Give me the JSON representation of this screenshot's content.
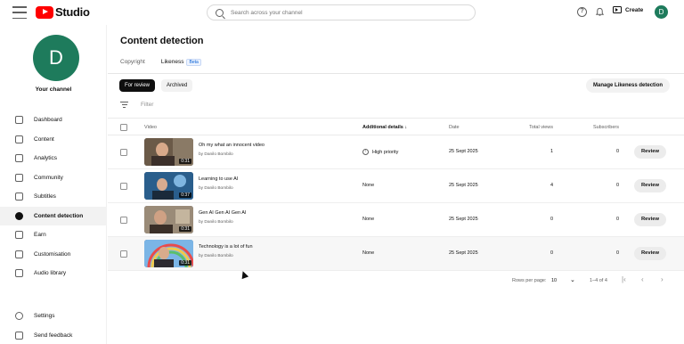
{
  "app": {
    "logo_text": "Studio"
  },
  "search": {
    "placeholder": "Search across your channel"
  },
  "header": {
    "create_label": "Create",
    "avatar_letter": "D",
    "help_icon": "help-icon",
    "bell_icon": "bell-icon"
  },
  "sidebar": {
    "avatar_letter": "D",
    "channel_label": "Your channel",
    "items": [
      {
        "label": "Dashboard",
        "icon": "dashboard-icon"
      },
      {
        "label": "Content",
        "icon": "content-icon"
      },
      {
        "label": "Analytics",
        "icon": "analytics-icon"
      },
      {
        "label": "Community",
        "icon": "community-icon"
      },
      {
        "label": "Subtitles",
        "icon": "subtitles-icon"
      },
      {
        "label": "Content detection",
        "icon": "content-detection-icon",
        "active": true
      },
      {
        "label": "Earn",
        "icon": "dollar-icon"
      },
      {
        "label": "Customisation",
        "icon": "customisation-icon"
      },
      {
        "label": "Audio library",
        "icon": "audio-library-icon"
      }
    ],
    "bottom": [
      {
        "label": "Settings",
        "icon": "gear-icon"
      },
      {
        "label": "Send feedback",
        "icon": "feedback-icon"
      }
    ]
  },
  "main": {
    "title": "Content detection",
    "tabs": [
      {
        "label": "Copyright"
      },
      {
        "label": "Likeness",
        "badge": "Beta",
        "active": true
      }
    ],
    "chips": {
      "review": "For review",
      "archived": "Archived"
    },
    "manage_button": "Manage Likeness detection",
    "filter_placeholder": "Filter"
  },
  "table": {
    "headers": {
      "video": "Video",
      "details": "Additional details",
      "date": "Date",
      "views": "Total views",
      "subscribers": "Subscribers"
    },
    "rows": [
      {
        "title": "Oh my what an innocent video",
        "by": "by Danilo Bombilo",
        "duration": "0:31",
        "details": "High priority",
        "date": "25 Sept 2025",
        "views": "1",
        "subscribers": "0",
        "action": "Review"
      },
      {
        "title": "Learning to use AI",
        "by": "by Danilo Bombilo",
        "duration": "0:37",
        "details": "None",
        "date": "25 Sept 2025",
        "views": "4",
        "subscribers": "0",
        "action": "Review"
      },
      {
        "title": "Gen AI Gen AI Gen AI",
        "by": "by Danilo Bombilo",
        "duration": "0:31",
        "details": "None",
        "date": "25 Sept 2025",
        "views": "0",
        "subscribers": "0",
        "action": "Review"
      },
      {
        "title": "Technology is a lot of fun",
        "by": "by Danilo Bombilo",
        "duration": "0:31",
        "details": "None",
        "date": "25 Sept 2025",
        "views": "0",
        "subscribers": "0",
        "action": "Review"
      }
    ]
  },
  "pagination": {
    "rows_label": "Rows per page:",
    "rows_value": "10",
    "range": "1–4 of 4"
  },
  "colors": {
    "brand_red": "#ff0000",
    "avatar_green": "#1e7b5c",
    "accent_blue": "#065fd4"
  }
}
